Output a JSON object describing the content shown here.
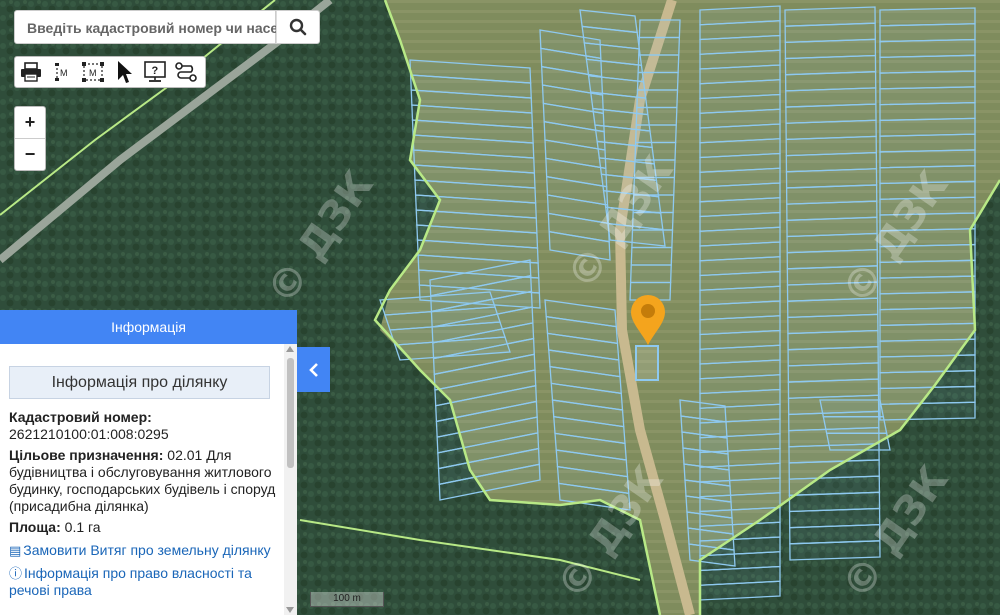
{
  "search": {
    "placeholder": "Введіть кадастровий номер чи насе..."
  },
  "toolbar": {
    "tools": [
      "printer-icon",
      "measure-distance-icon",
      "measure-area-icon",
      "cursor-icon",
      "help-icon",
      "route-icon"
    ],
    "measure_label": "M"
  },
  "zoom": {
    "in_label": "+",
    "out_label": "−"
  },
  "panel": {
    "header": "Інформація",
    "title": "Інформація про ділянку",
    "cadastral_label": "Кадастровий номер:",
    "cadastral_value": "2621210100:01:008:0295",
    "purpose_label": "Цільове призначення:",
    "purpose_value": " 02.01 Для будівництва і обслуговування житлового будинку, господарських будівель і споруд (присадибна ділянка)",
    "area_label": "Площа:",
    "area_value": " 0.1 га",
    "extract_link": "Замовити Витяг про земельну ділянку",
    "ownership_link": "Інформація про право власності та речові права"
  },
  "scale": {
    "label": "100 m"
  },
  "watermark": "© ДЗК",
  "colors": {
    "accent": "#4285f4",
    "parcel_stroke": "#8ec9f0",
    "boundary_green": "#b8e986",
    "marker": "#f4a41d",
    "forest": "#2c4a37",
    "field": "#7d8b5a"
  }
}
